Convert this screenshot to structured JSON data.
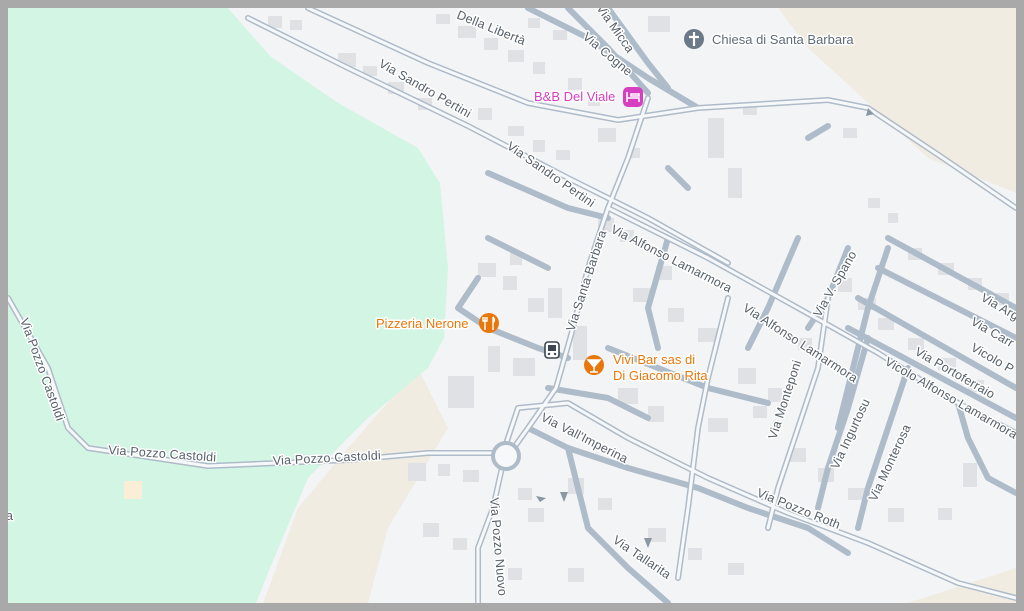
{
  "colors": {
    "park": "#d3f5e3",
    "sand": "#f1ece2",
    "background": "#f3f4f6",
    "road_casing": "#aebbc9",
    "building": "#dfe1e5",
    "food_poi": "#e8770b",
    "lodging_poi": "#d63fbf",
    "worship_poi": "#6c7a88"
  },
  "streets": {
    "della_liberta": "Della Libertà",
    "micca": "Via Micca",
    "cogne": "Via Cogne",
    "sandro_pertini_1": "Via Sandro Pertini",
    "sandro_pertini_2": "Via Sandro Pertini",
    "santa_barbara": "Via Santa Barbara",
    "lamarmora_1": "Via Alfonso Lamarmora",
    "lamarmora_2": "Via Alfonso Lamarmora",
    "v_spano": "Via V. Spano",
    "arg": "Via Arg",
    "carr": "Via Carr",
    "vicolo_p": "Vicolo P",
    "portoferraio": "Via Portoferraio",
    "vicolo_lamarmora": "Vicolo Alfonso Lamarmora",
    "monteponi": "Via Monteponi",
    "ingurtosu": "Via Ingurtosu",
    "monterosa": "Via Monterosa",
    "pozzo_castoldi_v": "Via Pozzo Castoldi",
    "pozzo_castoldi_1": "Via Pozzo Castoldi",
    "pozzo_castoldi_2": "Via Pozzo Castoldi",
    "vall_imperina": "Via Vall'Imperina",
    "pozzo_roth": "Via Pozzo Roth",
    "tallarita": "Via Tallarita",
    "pozzo_nuovo": "Via Pozzo Nuovo",
    "edge_a": "a"
  },
  "pois": {
    "chiesa": {
      "name": "Chiesa di Santa Barbara",
      "icon": "church-cross-icon"
    },
    "bnb": {
      "name": "B&B Del Viale",
      "icon": "bed-icon"
    },
    "pizzeria": {
      "name": "Pizzeria Nerone",
      "icon": "fork-knife-icon"
    },
    "vivi_bar": {
      "name_line1": "Vivi Bar sas di",
      "name_line2": "Di Giacomo Rita",
      "icon": "cocktail-icon"
    },
    "bus_stop": {
      "icon": "bus-stop-icon"
    }
  }
}
